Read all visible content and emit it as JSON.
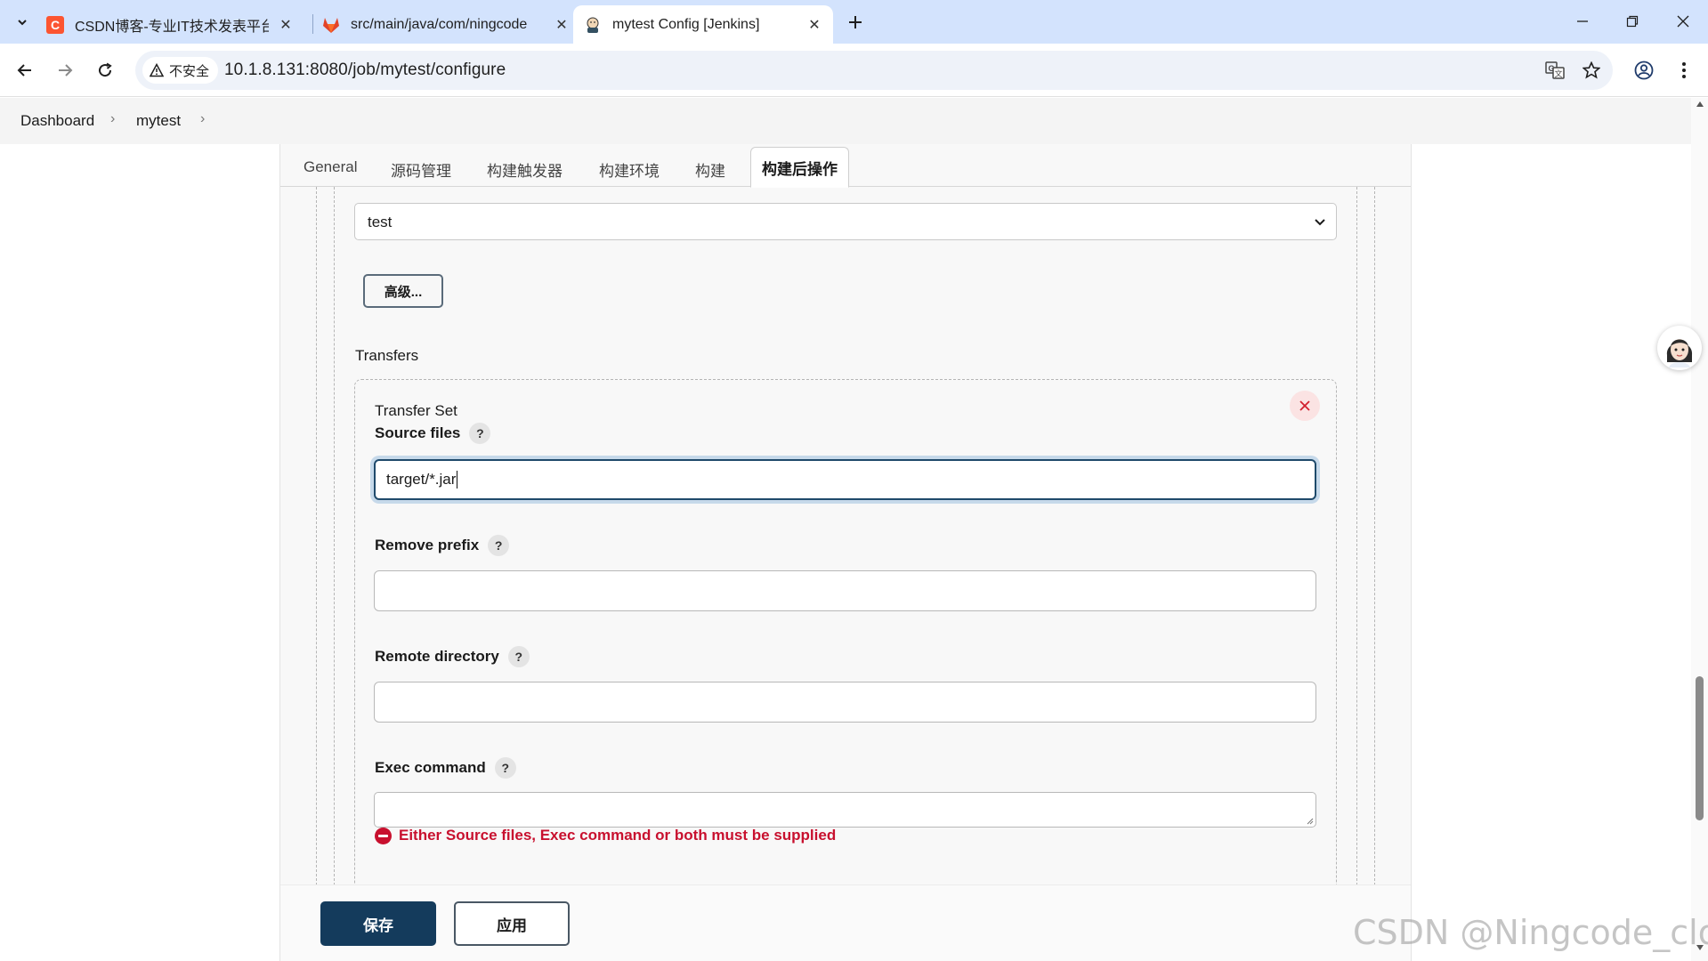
{
  "browser": {
    "tabs": [
      {
        "title": "CSDN博客-专业IT技术发表平台",
        "active": false
      },
      {
        "title": "src/main/java/com/ningcode",
        "active": false
      },
      {
        "title": "mytest Config [Jenkins]",
        "active": true
      }
    ],
    "security_label": "不安全",
    "url": "10.1.8.131:8080/job/mytest/configure"
  },
  "breadcrumb": {
    "items": [
      "Dashboard",
      "mytest"
    ]
  },
  "config_tabs": [
    "General",
    "源码管理",
    "构建触发器",
    "构建环境",
    "构建",
    "构建后操作"
  ],
  "active_tab": "构建后操作",
  "form": {
    "server_select_value": "test",
    "advanced_button": "高级...",
    "transfers_label": "Transfers",
    "transfer_set_label": "Transfer Set",
    "source_files_label": "Source files",
    "source_files_value": "target/*.jar",
    "remove_prefix_label": "Remove prefix",
    "remove_prefix_value": "",
    "remote_directory_label": "Remote directory",
    "remote_directory_value": "",
    "exec_command_label": "Exec command",
    "exec_command_value": "",
    "help_glyph": "?",
    "error_message": "Either Source files, Exec command or both must be supplied"
  },
  "actions": {
    "save": "保存",
    "apply": "应用"
  },
  "watermark": "CSDN @Ningcode_cloud",
  "colors": {
    "tabbar_bg": "#d3e3fd",
    "save_bg": "#143b5c",
    "error": "#c8102e",
    "focus_border": "#1f4a6b"
  }
}
